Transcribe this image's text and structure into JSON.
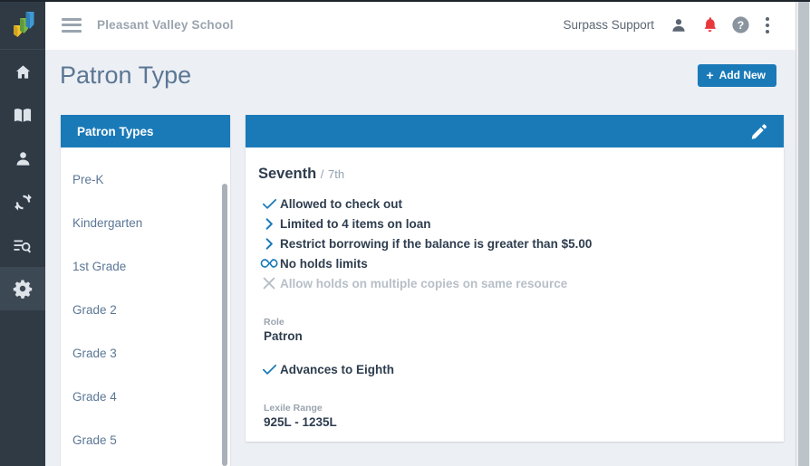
{
  "brand": {
    "logo_name": "surpass-logo",
    "logo_colors": [
      "#f2c230",
      "#7ab648",
      "#3d9ad6"
    ],
    "accent_blue": "#1a7ab8",
    "rail_bg": "#2f3a45"
  },
  "rail": {
    "items": [
      {
        "icon": "home-icon",
        "name": "home",
        "active": false
      },
      {
        "icon": "book-icon",
        "name": "catalog",
        "active": false
      },
      {
        "icon": "person-icon",
        "name": "patrons",
        "active": false
      },
      {
        "icon": "circulation-icon",
        "name": "circulation",
        "active": false
      },
      {
        "icon": "search-list-icon",
        "name": "reports",
        "active": false
      },
      {
        "icon": "gear-icon",
        "name": "settings",
        "active": true
      }
    ]
  },
  "topbar": {
    "menu_icon": "hamburger-icon",
    "school_name": "Pleasant Valley School",
    "support_user": "Surpass Support",
    "user_icon": "person-icon",
    "notification_icon": "bell-icon",
    "notification_color": "#e8383d",
    "help_icon": "help-circle-icon",
    "more_icon": "kebab-menu-icon"
  },
  "page": {
    "title": "Patron Type",
    "add_new_label": "Add New",
    "add_new_plus": "+"
  },
  "list_panel": {
    "header": "Patron Types",
    "items": [
      {
        "label": "Pre-K"
      },
      {
        "label": "Kindergarten"
      },
      {
        "label": "1st Grade"
      },
      {
        "label": "Grade 2"
      },
      {
        "label": "Grade 3"
      },
      {
        "label": "Grade 4"
      },
      {
        "label": "Grade 5"
      }
    ]
  },
  "detail": {
    "edit_icon": "pencil-icon",
    "title": "Seventh",
    "separator": "/",
    "title_alt": "7th",
    "attributes": [
      {
        "icon": "check-icon",
        "label": "Allowed to check out",
        "state": "on"
      },
      {
        "icon": "chevron-right-icon",
        "label": "Limited to 4 items on loan",
        "state": "on"
      },
      {
        "icon": "chevron-right-icon",
        "label": "Restrict borrowing if the balance is greater than $5.00",
        "state": "on"
      },
      {
        "icon": "infinity-icon",
        "label": "No holds limits",
        "state": "on"
      },
      {
        "icon": "x-icon",
        "label": "Allow holds on multiple copies on same resource",
        "state": "off"
      }
    ],
    "role_label": "Role",
    "role_value": "Patron",
    "advances_icon": "check-icon",
    "advances_label": "Advances to Eighth",
    "lexile_label": "Lexile Range",
    "lexile_value": "925L - 1235L"
  }
}
